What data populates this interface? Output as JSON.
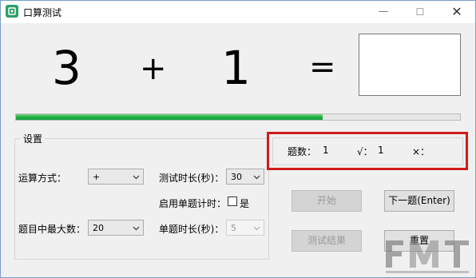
{
  "window": {
    "title": "口算测试",
    "min": "—",
    "max": "☐",
    "close": "✕"
  },
  "problem": {
    "operand1": "3",
    "operator": "+",
    "operand2": "1",
    "equals": "=",
    "answer": ""
  },
  "progress": {
    "fraction": 0.69
  },
  "settings": {
    "title": "设置",
    "operation_label": "运算方式：",
    "operation_value": "+",
    "max_number_label": "题目中最大数：",
    "max_number_value": "20",
    "duration_label": "测试时长(秒)：",
    "duration_value": "30",
    "timer_label": "启用单题计时：",
    "timer_checkbox_label": "是",
    "timer_checked": false,
    "per_question_label": "单题时长(秒)：",
    "per_question_value": "5"
  },
  "stats": {
    "count_label": "题数：",
    "count_value": "1",
    "correct_label": "√：",
    "correct_value": "1",
    "wrong_label": "×：",
    "wrong_value": ""
  },
  "buttons": {
    "start": "开始",
    "next": "下一题(Enter)",
    "results": "测试结果",
    "reset": "重置"
  },
  "colors": {
    "progress": "#1fae45",
    "highlight": "#d01c1c",
    "icon": "#2d9f6a"
  }
}
